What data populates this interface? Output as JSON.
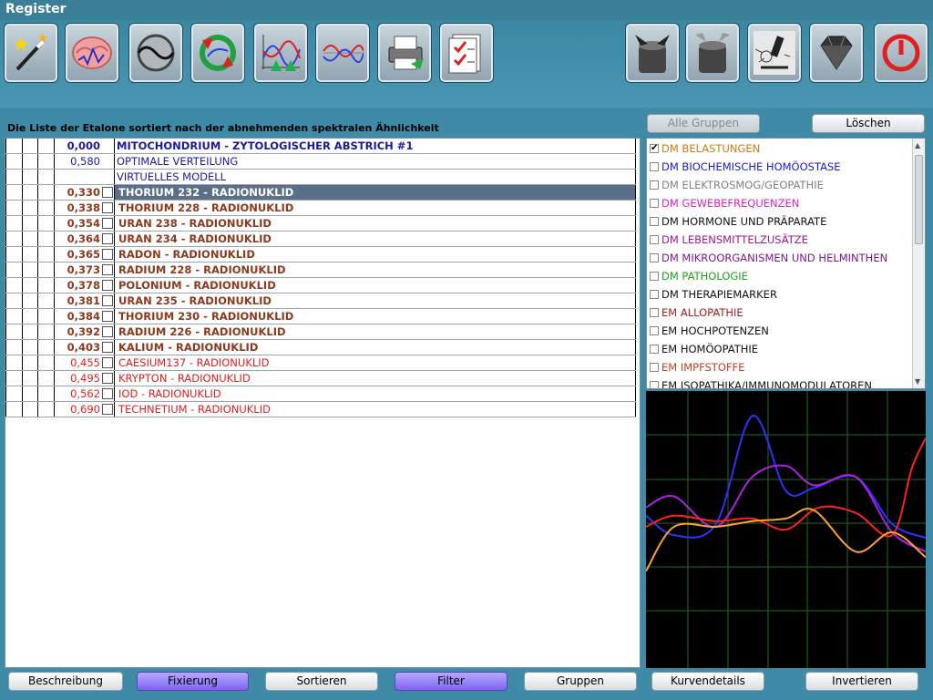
{
  "window": {
    "title": "Register"
  },
  "toolbar": {
    "buttons": [
      {
        "name": "magic-wand-button",
        "icon": "magic-wand-icon",
        "x": 4
      },
      {
        "name": "brain-button",
        "icon": "brain-icon",
        "x": 71
      },
      {
        "name": "wave-compare-button",
        "icon": "wave-circle-icon",
        "x": 141
      },
      {
        "name": "cycle-arrows-button",
        "icon": "cycle-arrows-icon",
        "x": 209
      },
      {
        "name": "graph-up-button",
        "icon": "graph-arrows-icon",
        "x": 278
      },
      {
        "name": "wave-graph-button",
        "icon": "wave-graph-icon",
        "x": 346
      },
      {
        "name": "printer-button",
        "icon": "printer-icon",
        "x": 414
      },
      {
        "name": "checklist-button",
        "icon": "checklist-icon",
        "x": 482
      },
      {
        "name": "funnel-down-button",
        "icon": "funnel-down-icon",
        "x": 686
      },
      {
        "name": "funnel-up-button",
        "icon": "funnel-up-icon",
        "x": 752
      },
      {
        "name": "microscope-button",
        "icon": "microscope-icon",
        "x": 820
      },
      {
        "name": "diamond-button",
        "icon": "diamond-icon",
        "x": 888
      },
      {
        "name": "power-button",
        "icon": "power-icon",
        "x": 959
      }
    ]
  },
  "list": {
    "title": "Die Liste der Etalone sortiert nach der abnehmenden spektralen Ähnlichkeit",
    "rows": [
      {
        "value": "0,000",
        "name": "MITOCHONDRIUM - ZYTOLOGISCHER ABSTRICH #1",
        "color": "#1a1a9a",
        "bold": true,
        "checkbox": false,
        "selected": false
      },
      {
        "value": "0,580",
        "name": "OPTIMALE VERTEILUNG",
        "color": "#1a1a9a",
        "bold": false,
        "checkbox": false,
        "selected": false
      },
      {
        "value": "",
        "name": "VIRTUELLES MODELL",
        "color": "#1a1a9a",
        "bold": false,
        "checkbox": false,
        "selected": false
      },
      {
        "value": "0,330",
        "name": "THORIUM 232 - RADIONUKLID",
        "color": "#8b3a1e",
        "bold": true,
        "checkbox": true,
        "selected": true
      },
      {
        "value": "0,338",
        "name": "THORIUM 228 - RADIONUKLID",
        "color": "#8b3a1e",
        "bold": true,
        "checkbox": true,
        "selected": false
      },
      {
        "value": "0,354",
        "name": "URAN 238 - RADIONUKLID",
        "color": "#8b3a1e",
        "bold": true,
        "checkbox": true,
        "selected": false
      },
      {
        "value": "0,364",
        "name": "URAN 234 - RADIONUKLID",
        "color": "#8b3a1e",
        "bold": true,
        "checkbox": true,
        "selected": false
      },
      {
        "value": "0,365",
        "name": "RADON - RADIONUKLID",
        "color": "#8b3a1e",
        "bold": true,
        "checkbox": true,
        "selected": false
      },
      {
        "value": "0,373",
        "name": "RADIUM 228 - RADIONUKLID",
        "color": "#8b3a1e",
        "bold": true,
        "checkbox": true,
        "selected": false
      },
      {
        "value": "0,378",
        "name": "POLONIUM - RADIONUKLID",
        "color": "#8b3a1e",
        "bold": true,
        "checkbox": true,
        "selected": false
      },
      {
        "value": "0,381",
        "name": "URAN 235 - RADIONUKLID",
        "color": "#8b3a1e",
        "bold": true,
        "checkbox": true,
        "selected": false
      },
      {
        "value": "0,384",
        "name": "THORIUM 230 - RADIONUKLID",
        "color": "#8b3a1e",
        "bold": true,
        "checkbox": true,
        "selected": false
      },
      {
        "value": "0,392",
        "name": "RADIUM 226 - RADIONUKLID",
        "color": "#8b3a1e",
        "bold": true,
        "checkbox": true,
        "selected": false
      },
      {
        "value": "0,403",
        "name": "KALIUM - RADIONUKLID",
        "color": "#8b3a1e",
        "bold": true,
        "checkbox": true,
        "selected": false
      },
      {
        "value": "0,455",
        "name": "CAESIUM137 - RADIONUKLID",
        "color": "#e02020",
        "bold": false,
        "checkbox": true,
        "selected": false
      },
      {
        "value": "0,495",
        "name": "KRYPTON - RADIONUKLID",
        "color": "#e02020",
        "bold": false,
        "checkbox": true,
        "selected": false
      },
      {
        "value": "0,562",
        "name": "IOD - RADIONUKLID",
        "color": "#e02020",
        "bold": false,
        "checkbox": true,
        "selected": false
      },
      {
        "value": "0,690",
        "name": "TECHNETIUM - RADIONUKLID",
        "color": "#e02020",
        "bold": false,
        "checkbox": true,
        "selected": false
      }
    ]
  },
  "bottom_buttons": {
    "beschreibung": "Beschreibung",
    "fixierung": "Fixierung",
    "sortieren": "Sortieren",
    "filter": "Filter",
    "gruppen": "Gruppen",
    "kurvendetails": "Kurvendetails",
    "invertieren": "Invertieren"
  },
  "group_panel": {
    "all_groups": "Alle Gruppen",
    "delete": "Löschen",
    "items": [
      {
        "label": "DM BELASTUNGEN",
        "color": "#d07a10",
        "checked": true
      },
      {
        "label": "DM BIOCHEMISCHE HOMÖOSTASE",
        "color": "#1a1acc",
        "checked": false
      },
      {
        "label": "DM ELEKTROSMOG/GEOPATHIE",
        "color": "#808080",
        "checked": false
      },
      {
        "label": "DM GEWEBEFREQUENZEN",
        "color": "#e020c0",
        "checked": false
      },
      {
        "label": "DM HORMONE UND PRÄPARATE",
        "color": "#111111",
        "checked": false
      },
      {
        "label": "DM LEBENSMITTELZUSÄTZE",
        "color": "#a01890",
        "checked": false
      },
      {
        "label": "DM MIKROORGANISMEN UND HELMINTHEN",
        "color": "#7a1a8a",
        "checked": false
      },
      {
        "label": "DM PATHOLOGIE",
        "color": "#20a020",
        "checked": false
      },
      {
        "label": "DM THERAPIEMARKER",
        "color": "#111111",
        "checked": false
      },
      {
        "label": "EM ALLOPATHIE",
        "color": "#a02020",
        "checked": false
      },
      {
        "label": "EM HOCHPOTENZEN",
        "color": "#111111",
        "checked": false
      },
      {
        "label": "EM HOMÖOPATHIE",
        "color": "#111111",
        "checked": false
      },
      {
        "label": "EM IMPFSTOFFE",
        "color": "#c04020",
        "checked": false
      },
      {
        "label": "EM ISOPATHIKA/IMMUNOMODULATOREN",
        "color": "#111111",
        "checked": false
      }
    ]
  },
  "curves": {
    "series": [
      {
        "color": "#3030ff",
        "points": [
          [
            0,
            0.45
          ],
          [
            0.1,
            0.52
          ],
          [
            0.25,
            0.48
          ],
          [
            0.38,
            0.09
          ],
          [
            0.5,
            0.36
          ],
          [
            0.6,
            0.35
          ],
          [
            0.75,
            0.31
          ],
          [
            0.88,
            0.48
          ],
          [
            1,
            0.53
          ]
        ]
      },
      {
        "color": "#b020e0",
        "points": [
          [
            0,
            0.42
          ],
          [
            0.1,
            0.38
          ],
          [
            0.25,
            0.49
          ],
          [
            0.38,
            0.31
          ],
          [
            0.5,
            0.27
          ],
          [
            0.6,
            0.34
          ],
          [
            0.75,
            0.31
          ],
          [
            0.88,
            0.51
          ],
          [
            1,
            0.58
          ]
        ]
      },
      {
        "color": "#ff2020",
        "points": [
          [
            0,
            0.49
          ],
          [
            0.1,
            0.45
          ],
          [
            0.25,
            0.47
          ],
          [
            0.38,
            0.46
          ],
          [
            0.5,
            0.5
          ],
          [
            0.62,
            0.42
          ],
          [
            0.75,
            0.44
          ],
          [
            0.88,
            0.52
          ],
          [
            0.95,
            0.28
          ],
          [
            1,
            0.17
          ]
        ]
      },
      {
        "color": "#ffa030",
        "points": [
          [
            0,
            0.65
          ],
          [
            0.1,
            0.49
          ],
          [
            0.25,
            0.49
          ],
          [
            0.38,
            0.47
          ],
          [
            0.5,
            0.46
          ],
          [
            0.6,
            0.43
          ],
          [
            0.75,
            0.58
          ],
          [
            0.88,
            0.51
          ],
          [
            1,
            0.6
          ]
        ]
      }
    ]
  }
}
